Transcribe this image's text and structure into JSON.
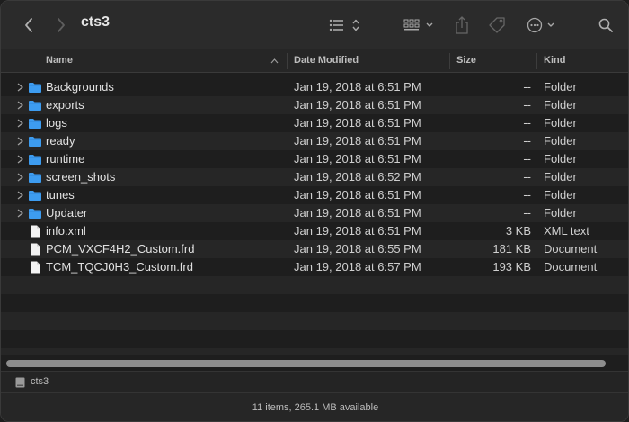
{
  "window": {
    "title": "cts3"
  },
  "toolbar": {
    "back_icon": "chevron-left-icon",
    "forward_icon": "chevron-right-icon",
    "list_view_icon": "list-icon",
    "group_icon": "grid-icon",
    "share_icon": "share-icon",
    "tag_icon": "tag-icon",
    "action_icon": "ellipsis-circle-icon",
    "search_icon": "search-icon"
  },
  "columns": {
    "name": "Name",
    "date": "Date Modified",
    "size": "Size",
    "kind": "Kind"
  },
  "files": [
    {
      "name": "Backgrounds",
      "date": "Jan 19, 2018 at 6:51 PM",
      "size": "--",
      "kind": "Folder",
      "type": "folder"
    },
    {
      "name": "exports",
      "date": "Jan 19, 2018 at 6:51 PM",
      "size": "--",
      "kind": "Folder",
      "type": "folder"
    },
    {
      "name": "logs",
      "date": "Jan 19, 2018 at 6:51 PM",
      "size": "--",
      "kind": "Folder",
      "type": "folder"
    },
    {
      "name": "ready",
      "date": "Jan 19, 2018 at 6:51 PM",
      "size": "--",
      "kind": "Folder",
      "type": "folder"
    },
    {
      "name": "runtime",
      "date": "Jan 19, 2018 at 6:51 PM",
      "size": "--",
      "kind": "Folder",
      "type": "folder"
    },
    {
      "name": "screen_shots",
      "date": "Jan 19, 2018 at 6:52 PM",
      "size": "--",
      "kind": "Folder",
      "type": "folder"
    },
    {
      "name": "tunes",
      "date": "Jan 19, 2018 at 6:51 PM",
      "size": "--",
      "kind": "Folder",
      "type": "folder"
    },
    {
      "name": "Updater",
      "date": "Jan 19, 2018 at 6:51 PM",
      "size": "--",
      "kind": "Folder",
      "type": "folder"
    },
    {
      "name": "info.xml",
      "date": "Jan 19, 2018 at 6:51 PM",
      "size": "3 KB",
      "kind": "XML text",
      "type": "file"
    },
    {
      "name": "PCM_VXCF4H2_Custom.frd",
      "date": "Jan 19, 2018 at 6:55 PM",
      "size": "181 KB",
      "kind": "Document",
      "type": "file"
    },
    {
      "name": "TCM_TQCJ0H3_Custom.frd",
      "date": "Jan 19, 2018 at 6:57 PM",
      "size": "193 KB",
      "kind": "Document",
      "type": "file"
    }
  ],
  "pathbar": {
    "text": "cts3",
    "icon": "disk-icon"
  },
  "status": {
    "text": "11 items, 265.1 MB available"
  },
  "colors": {
    "folder": "#3d9cf0",
    "background": "#1e1e1e",
    "stripe": "#262626"
  }
}
